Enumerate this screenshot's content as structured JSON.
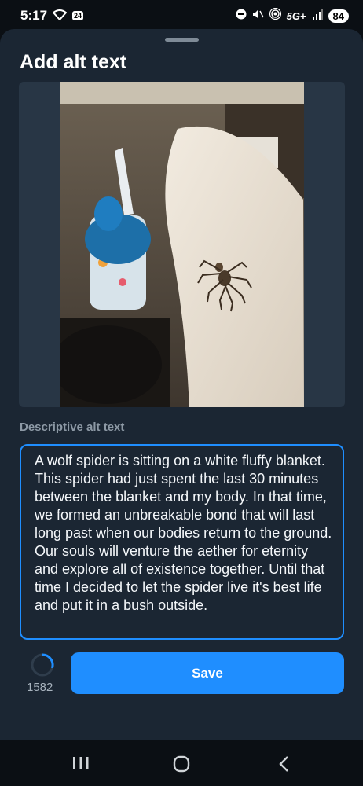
{
  "status_bar": {
    "time": "5:17",
    "badge": "24",
    "network": "5G+",
    "battery": "84"
  },
  "sheet": {
    "title": "Add alt text",
    "alt_label": "Descriptive alt text",
    "alt_text": "A wolf spider is sitting on a white fluffy blanket. This spider had just spent the last 30 minutes between the blanket and my body. In that time, we formed an unbreakable bond that will last long past when our bodies return to the ground. Our souls will venture the aether for eternity and explore all of existence together. Until that time I decided to let the spider live it's best life and put it in a bush outside.",
    "char_count": "1582",
    "save_label": "Save"
  },
  "colors": {
    "accent": "#1f8eff",
    "sheet_bg": "#1b2633",
    "page_bg": "#0b0f14"
  },
  "icons": {
    "status": [
      "wifi-icon",
      "calendar-badge-icon",
      "dnd-icon",
      "mute-icon",
      "hotspot-icon",
      "signal-icon",
      "battery-icon"
    ],
    "nav": [
      "recents-icon",
      "home-icon",
      "back-icon"
    ]
  }
}
